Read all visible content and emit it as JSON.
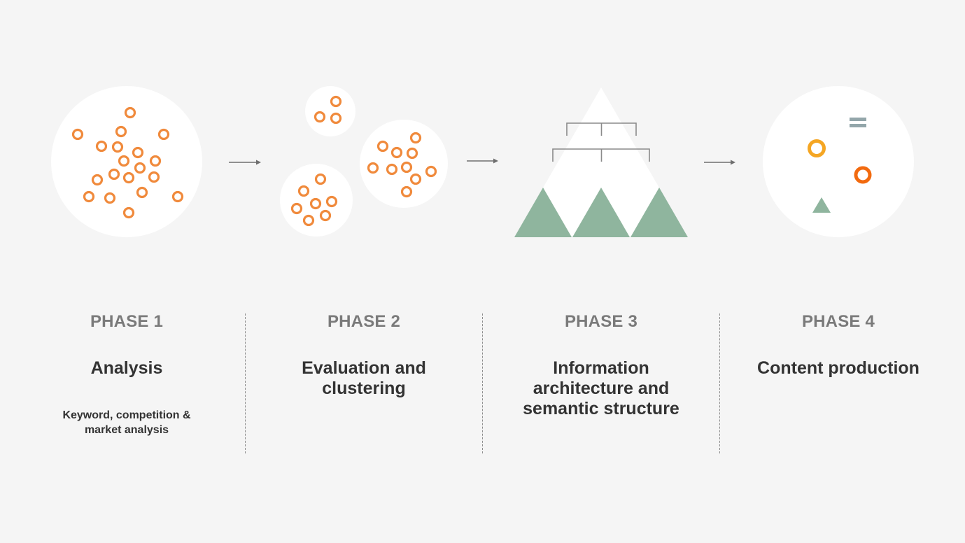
{
  "colors": {
    "background": "#f5f5f5",
    "circle_fill": "#ffffff",
    "dot_orange": "#f08a3c",
    "accent_yellow": "#f5a623",
    "accent_red_orange": "#f26a0f",
    "green": "#8fb59e",
    "tree_lines": "#8a8a8a",
    "equals_icon": "#93a6aa",
    "arrow": "#6e6e6e",
    "phase_label": "#7a7a7a",
    "text_dark": "#333333"
  },
  "phases": [
    {
      "label": "PHASE 1",
      "title": "Analysis",
      "description": "Keyword, competition &\nmarket analysis",
      "illustration": "scattered-keywords"
    },
    {
      "label": "PHASE 2",
      "title": "Evaluation and\nclustering",
      "description": "",
      "illustration": "keyword-clusters"
    },
    {
      "label": "PHASE 3",
      "title": "Information\narchitecture and\nsemantic structure",
      "description": "",
      "illustration": "hierarchy-pyramid"
    },
    {
      "label": "PHASE 4",
      "title": "Content production",
      "description": "",
      "illustration": "content-elements"
    }
  ],
  "connectors": [
    "arrow-right-icon",
    "arrow-right-icon",
    "arrow-right-icon"
  ]
}
